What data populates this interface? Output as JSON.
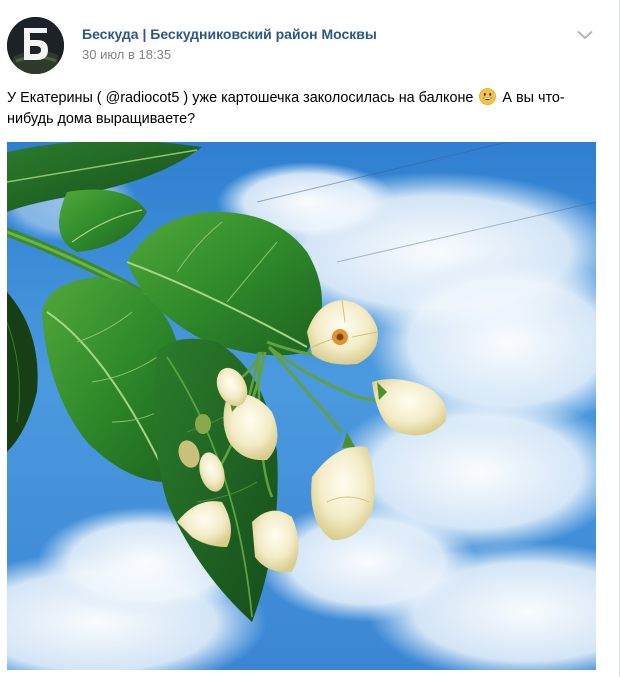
{
  "post": {
    "author": "Бескуда | Бескудниковский район Москвы",
    "date": "30 июл в 18:35",
    "text_before_emoji": "У Екатерины ( @radiocot5 ) уже картошечка заколосилась на балконе",
    "text_after_emoji": "А вы что-нибудь дома выращиваете?",
    "avatar_letter": "Б"
  },
  "icons": {
    "menu": "chevron-down-icon",
    "emoji": "grinning-face-icon"
  },
  "colors": {
    "author_link": "#2a5885",
    "date_text": "#828282",
    "sky": "#3f8fd6",
    "leaf": "#2f8a2a"
  }
}
